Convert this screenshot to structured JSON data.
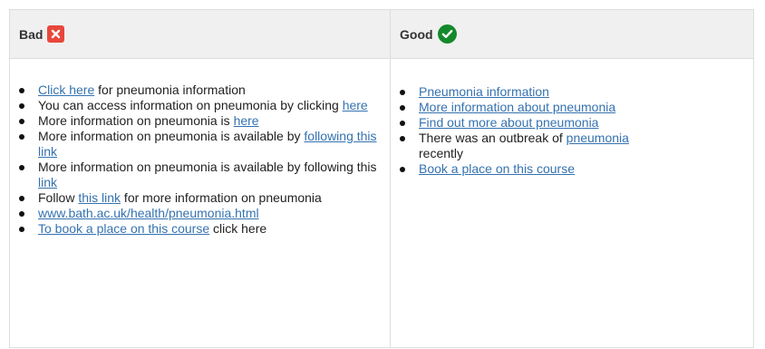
{
  "header": {
    "bad_label": "Bad",
    "good_label": "Good",
    "bad_icon": "close-icon",
    "good_icon": "checkmark-icon",
    "bad_icon_color": "#e8473b",
    "good_icon_color": "#14892c"
  },
  "colors": {
    "link": "#3572b0",
    "header_background": "#f0f0f0",
    "border": "#dddddd"
  },
  "bad": {
    "items": [
      {
        "link": "Click here",
        "after": " for pneumonia information"
      },
      {
        "before": "You can access information on pneumonia by clicking ",
        "link": "here"
      },
      {
        "before": "More information on pneumonia is ",
        "link": "here"
      },
      {
        "before": "More information on pneumonia is available by ",
        "link": "following this link"
      },
      {
        "before": "More information on pneumonia is available by following this ",
        "link": "link"
      },
      {
        "before": "Follow ",
        "link": "this link",
        "after": " for more information on pneumonia"
      },
      {
        "link": "www.bath.ac.uk/health/pneumonia.html"
      },
      {
        "link": "To book a place on this course",
        "after": " click here"
      }
    ]
  },
  "good": {
    "items": [
      {
        "link": "Pneumonia information"
      },
      {
        "link": "More information about pneumonia"
      },
      {
        "link": "Find out more about pneumonia"
      },
      {
        "before": "There was an outbreak of ",
        "link": "pneumonia",
        "after": " recently"
      },
      {
        "link": "Book a place on this course"
      }
    ]
  }
}
